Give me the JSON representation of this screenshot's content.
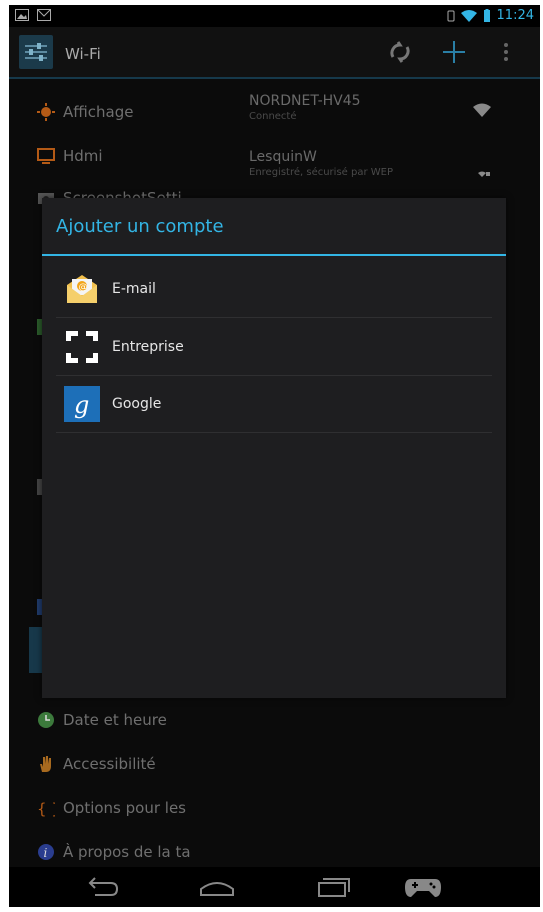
{
  "status_bar": {
    "time": "11:24"
  },
  "action_bar": {
    "title": "Wi-Fi"
  },
  "background_settings": [
    {
      "label": "Affichage"
    },
    {
      "label": "Hdmi"
    },
    {
      "label": "ScreenshotSetti"
    },
    {
      "label": "Date et heure"
    },
    {
      "label": "Accessibilité"
    },
    {
      "label": "Options pour les"
    },
    {
      "label": "À propos de la ta"
    }
  ],
  "wifi_networks": [
    {
      "name": "NORDNET-HV45",
      "status": "Connecté"
    },
    {
      "name": "LesquinW",
      "status": "Enregistré, sécurisé par WEP"
    }
  ],
  "dialog": {
    "title": "Ajouter un compte",
    "accounts": [
      {
        "label": "E-mail",
        "icon": "email-icon"
      },
      {
        "label": "Entreprise",
        "icon": "enterprise-icon"
      },
      {
        "label": "Google",
        "icon": "google-icon"
      }
    ]
  },
  "colors": {
    "accent": "#33b5e5",
    "dialog_bg": "#1e1e20",
    "screen_bg": "#0b0b0b"
  }
}
